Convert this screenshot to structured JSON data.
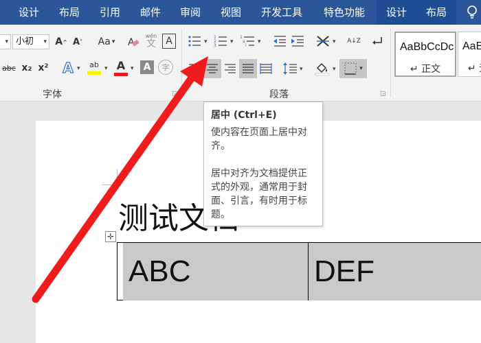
{
  "tabs": [
    {
      "label": "设计"
    },
    {
      "label": "布局"
    },
    {
      "label": "引用"
    },
    {
      "label": "邮件"
    },
    {
      "label": "审阅"
    },
    {
      "label": "视图"
    },
    {
      "label": "开发工具"
    },
    {
      "label": "特色功能"
    },
    {
      "label": "设计"
    },
    {
      "label": "布局"
    }
  ],
  "ribbon": {
    "font_group": {
      "label": "字体",
      "font_size_value": "小初",
      "change_case_label": "Aa",
      "strikethrough_label": "abc",
      "subscript_label": "x₂",
      "superscript_label": "x²",
      "text_effect_label": "A",
      "highlight_label": "ab",
      "font_color_label": "A",
      "char_shading_label": "A",
      "enclosed_char_label": "字",
      "phonetic_label": "wén",
      "char_border_label": "A",
      "grow_label": "A",
      "shrink_label": "A",
      "font_color": "#e11d1d",
      "highlight_color": "#f5f500"
    },
    "paragraph_group": {
      "label": "段落",
      "sort_label": "A↓Z"
    },
    "styles_group": {
      "items": [
        {
          "sample": "AaBbCcDc",
          "name": "↵ 正文"
        },
        {
          "sample": "AaB",
          "name": "↵ 无"
        }
      ]
    }
  },
  "tooltip": {
    "title": "居中 (Ctrl+E)",
    "description": "使内容在页面上居中对齐。",
    "detail": "居中对齐为文档提供正式的外观，通常用于封面、引言，有时用于标题。"
  },
  "document": {
    "title": "测试文档",
    "table_move_glyph": "✛",
    "table": {
      "cells": [
        "ABC",
        "DEF"
      ]
    }
  },
  "colors": {
    "ribbon_tab_bg": "#2b579a",
    "contextual_tab_bg": "#1f4e93",
    "annotation_arrow": "#ee1c1c",
    "table_cell_shading": "#c9c9c9"
  }
}
